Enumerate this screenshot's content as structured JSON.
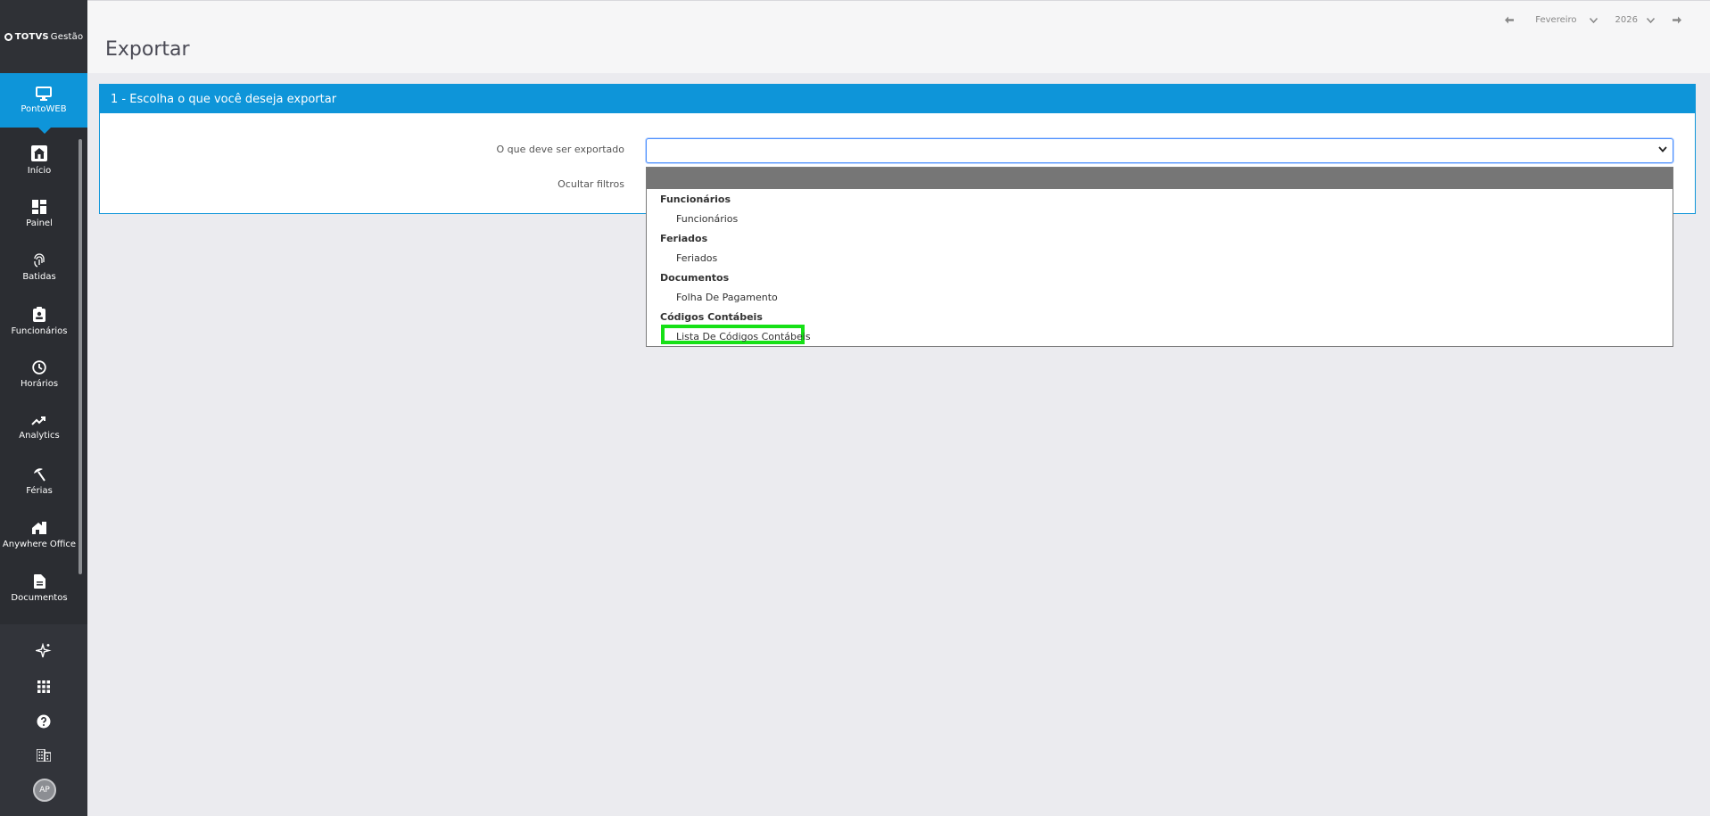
{
  "brand": {
    "bold": "TOTVS",
    "light": "Gestão"
  },
  "active_app": {
    "label": "PontoWEB"
  },
  "sidebar": {
    "items": [
      {
        "label": "Início"
      },
      {
        "label": "Painel"
      },
      {
        "label": "Batidas"
      },
      {
        "label": "Funcionários"
      },
      {
        "label": "Horários"
      },
      {
        "label": "Analytics"
      },
      {
        "label": "Férias"
      },
      {
        "label": "Anywhere Office"
      },
      {
        "label": "Documentos"
      }
    ]
  },
  "user": {
    "initials": "AP"
  },
  "header": {
    "title": "Exportar"
  },
  "period": {
    "month": "Fevereiro",
    "year": "2026"
  },
  "panel": {
    "title": "1 - Escolha o que você deseja exportar",
    "export_label": "O que deve ser exportado",
    "filters_label": "Ocultar filtros",
    "select_value": ""
  },
  "dropdown": {
    "groups": [
      {
        "label": "Funcionários",
        "options": [
          "Funcionários"
        ]
      },
      {
        "label": "Feriados",
        "options": [
          "Feriados"
        ]
      },
      {
        "label": "Documentos",
        "options": [
          "Folha De Pagamento"
        ]
      },
      {
        "label": "Códigos Contábeis",
        "options": [
          "Lista De Códigos Contábeis"
        ]
      }
    ]
  },
  "colors": {
    "accent": "#0e95d9",
    "sidebar": "#2b2d32",
    "focus": "#16e016"
  }
}
